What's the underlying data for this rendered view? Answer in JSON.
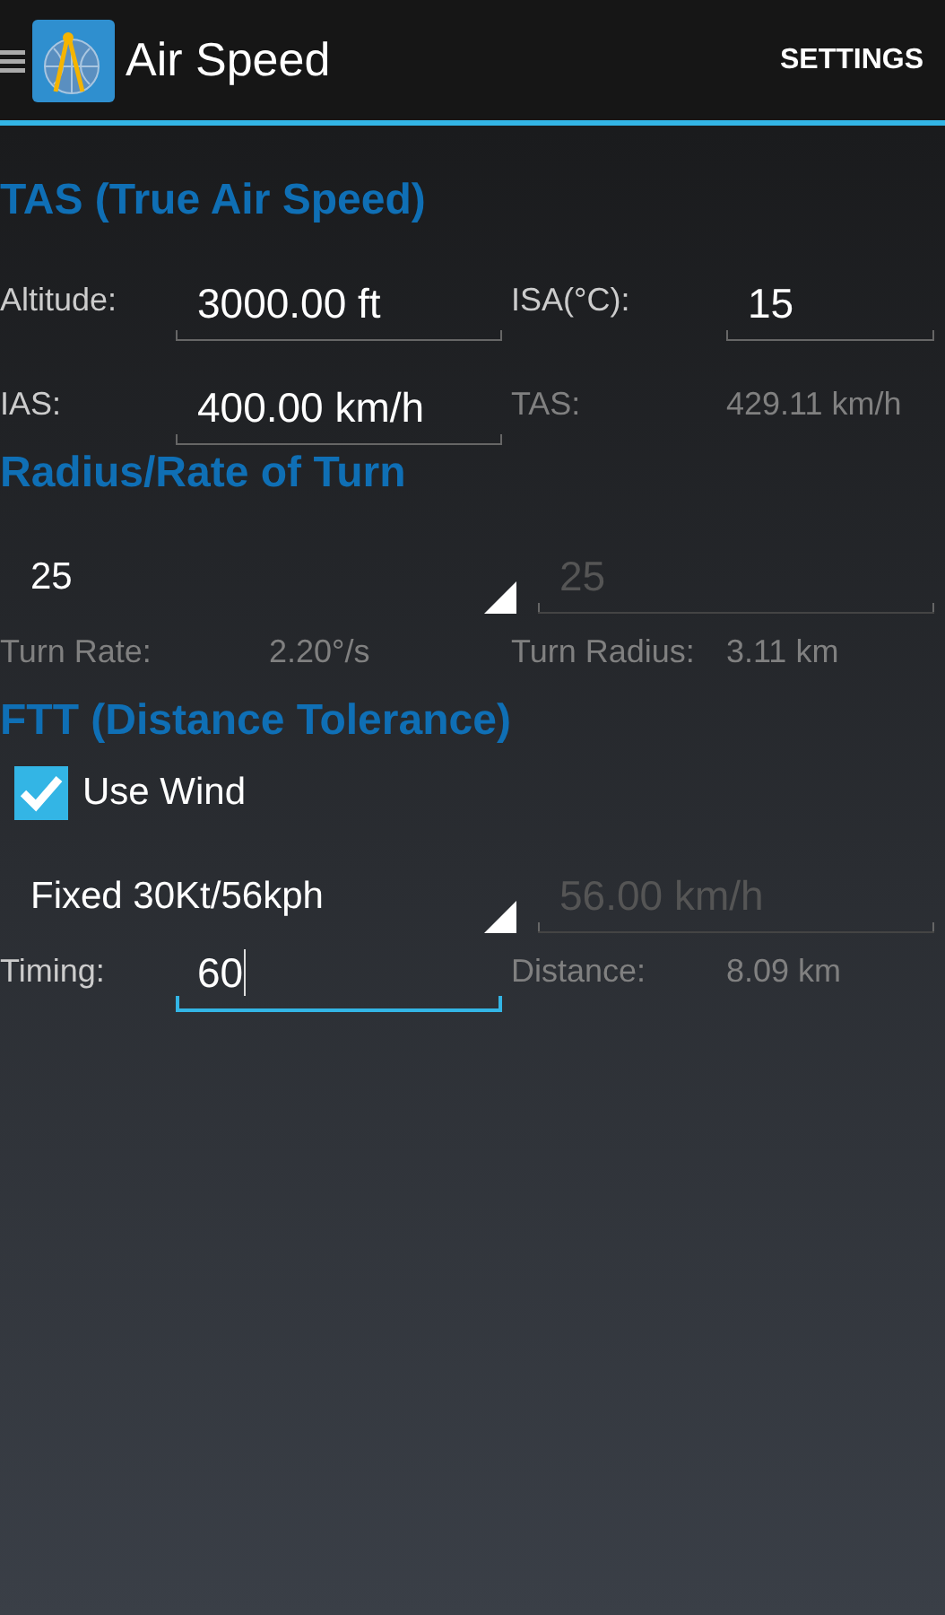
{
  "app_bar": {
    "title": "Air Speed",
    "action": "SETTINGS"
  },
  "sections": [
    {
      "title": "TAS (True Air Speed)",
      "rows": [
        {
          "kind": "grid",
          "items": [
            {
              "kind": "label",
              "text": "Altitude:"
            },
            {
              "kind": "field",
              "value": "3000.00 ft",
              "disabled": false,
              "focused": false
            },
            {
              "kind": "label",
              "text": "ISA(°C):"
            },
            {
              "kind": "field",
              "value": "15",
              "disabled": false,
              "focused": false
            }
          ]
        },
        {
          "kind": "grid",
          "items": [
            {
              "kind": "label",
              "text": "IAS:"
            },
            {
              "kind": "field",
              "value": "400.00 km/h",
              "disabled": false,
              "focused": false
            },
            {
              "kind": "result_label",
              "text": "TAS:"
            },
            {
              "kind": "output",
              "text": "429.11 km/h"
            }
          ]
        }
      ]
    },
    {
      "title": "Radius/Rate of Turn",
      "rows": [
        {
          "kind": "spinner",
          "value": "25",
          "field": {
            "value": "25",
            "disabled": true,
            "focused": false
          }
        },
        {
          "kind": "grid",
          "items": [
            {
              "kind": "result_label",
              "text": "Turn Rate:"
            },
            {
              "kind": "output",
              "text": "2.20°/s"
            },
            {
              "kind": "result_label",
              "text": "Turn Radius:"
            },
            {
              "kind": "output",
              "text": "3.11 km"
            }
          ]
        }
      ]
    },
    {
      "title": "FTT (Distance Tolerance)",
      "rows": [
        {
          "kind": "checkbox",
          "label": "Use Wind",
          "checked": true
        },
        {
          "kind": "spinner",
          "value": "Fixed 30Kt/56kph",
          "field": {
            "value": "56.00 km/h",
            "disabled": true,
            "focused": false
          }
        },
        {
          "kind": "grid",
          "items": [
            {
              "kind": "label",
              "text": "Timing:"
            },
            {
              "kind": "field",
              "value": "60",
              "disabled": false,
              "focused": true
            },
            {
              "kind": "result_label",
              "text": "Distance:"
            },
            {
              "kind": "output",
              "text": "8.09 km"
            }
          ]
        }
      ]
    }
  ]
}
